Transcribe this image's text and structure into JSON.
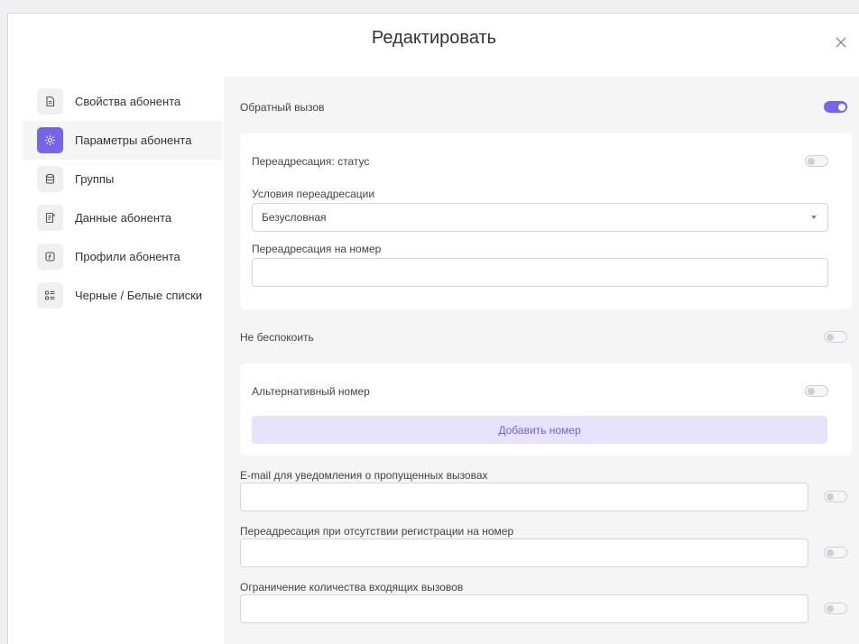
{
  "dialog": {
    "title": "Редактировать"
  },
  "sidebar": {
    "items": [
      {
        "label": "Свойства абонента",
        "icon": "document-icon",
        "active": false
      },
      {
        "label": "Параметры абонента",
        "icon": "settings-icon",
        "active": true
      },
      {
        "label": "Группы",
        "icon": "database-icon",
        "active": false
      },
      {
        "label": "Данные абонента",
        "icon": "clipboard-icon",
        "active": false
      },
      {
        "label": "Профили абонента",
        "icon": "profile-icon",
        "active": false
      },
      {
        "label": "Черные / Белые списки",
        "icon": "list-icon",
        "active": false
      }
    ]
  },
  "main": {
    "callback": {
      "label": "Обратный вызов",
      "enabled": true
    },
    "forwarding_card": {
      "status_label": "Переадресация: статус",
      "status_enabled": false,
      "conditions_label": "Условия переадресации",
      "conditions_value": "Безусловная",
      "forward_number_label": "Переадресация на номер",
      "forward_number_value": ""
    },
    "dnd": {
      "label": "Не беспокоить",
      "enabled": false
    },
    "alt_card": {
      "label": "Альтернативный номер",
      "enabled": false,
      "add_button": "Добавить номер"
    },
    "email": {
      "label": "E-mail для уведомления о пропущенных вызовах",
      "value": "",
      "enabled": false
    },
    "unreg_forward": {
      "label": "Переадресация при отсутствии регистрации на номер",
      "value": "",
      "enabled": false
    },
    "call_limit": {
      "label": "Ограничение количества входящих вызовов",
      "value": "",
      "enabled": false
    }
  },
  "colors": {
    "accent": "#7464f0",
    "accent_light": "#e6e3fb",
    "panel_bg": "#f5f5f6",
    "border": "#d6d6da"
  }
}
